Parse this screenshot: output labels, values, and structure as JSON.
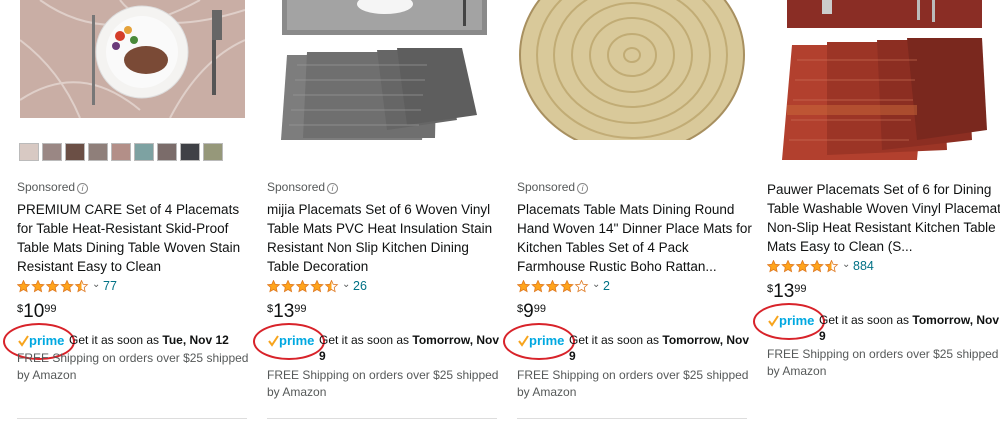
{
  "products": [
    {
      "sponsored": "Sponsored",
      "title": "PREMIUM CARE Set of 4 Placemats for Table Heat-Resistant Skid-Proof Table Mats Dining Table Woven Stain Resistant Easy to Clean",
      "rating": 4.5,
      "reviews": "77",
      "price_symbol": "$",
      "price_whole": "10",
      "price_fraction": "99",
      "delivery_prefix": "Get it as soon as",
      "delivery_date": "Tue, Nov 12",
      "shipping": "FREE Shipping on orders over $25 shipped by Amazon",
      "swatch_colors": [
        "#d8c9c3",
        "#9a8784",
        "#6b4f45",
        "#8f7f7a",
        "#b38f88",
        "#7da2a2",
        "#7b6c6a",
        "#3f4146",
        "#96987a"
      ]
    },
    {
      "sponsored": "Sponsored",
      "title": "mijia Placemats Set of 6 Woven Vinyl Table Mats PVC Heat Insulation Stain Resistant Non Slip Kitchen Dining Table Decoration",
      "rating": 4.5,
      "reviews": "26",
      "price_symbol": "$",
      "price_whole": "13",
      "price_fraction": "99",
      "delivery_prefix": "Get it as soon as",
      "delivery_date": "Tomorrow, Nov 9",
      "shipping": "FREE Shipping on orders over $25 shipped by Amazon"
    },
    {
      "sponsored": "Sponsored",
      "title": "Placemats Table Mats Dining Round Hand Woven 14\" Dinner Place Mats for Kitchen Tables Set of 4 Pack Farmhouse Rustic Boho Rattan...",
      "rating": 4.0,
      "reviews": "2",
      "price_symbol": "$",
      "price_whole": "9",
      "price_fraction": "99",
      "delivery_prefix": "Get it as soon as",
      "delivery_date": "Tomorrow, Nov 9",
      "shipping": "FREE Shipping on orders over $25 shipped by Amazon"
    },
    {
      "title": "Pauwer Placemats Set of 6 for Dining Table Washable Woven Vinyl Placemat Non-Slip Heat Resistant Kitchen Table Mats Easy to Clean (S...",
      "rating": 4.5,
      "reviews": "884",
      "price_symbol": "$",
      "price_whole": "13",
      "price_fraction": "99",
      "delivery_prefix": "Get it as soon as",
      "delivery_date": "Tomorrow, Nov 9",
      "shipping": "FREE Shipping on orders over $25 shipped by Amazon"
    }
  ],
  "prime_label": "prime",
  "colors": {
    "star": "#FFA41C",
    "link": "#007185",
    "prime_blue": "#00A8E1",
    "prime_check": "#F7A41D",
    "annotation_circle": "#d8232a"
  }
}
